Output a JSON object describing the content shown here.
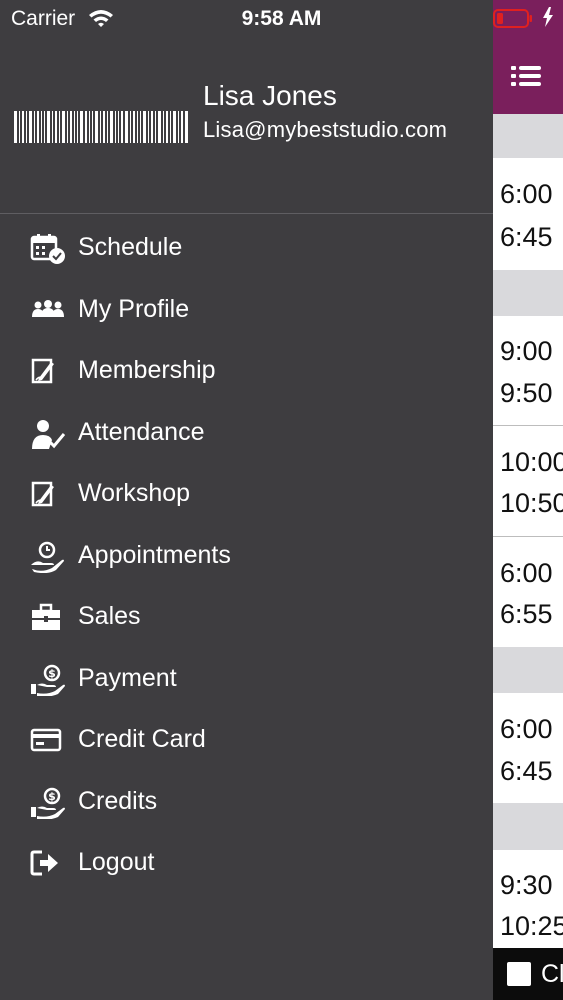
{
  "status_bar": {
    "carrier": "Carrier",
    "time": "9:58 AM"
  },
  "profile": {
    "name": "Lisa Jones",
    "email": "Lisa@mybeststudio.com"
  },
  "menu": [
    {
      "label": "Schedule",
      "icon": "calendar-check-icon"
    },
    {
      "label": "My Profile",
      "icon": "users-icon"
    },
    {
      "label": "Membership",
      "icon": "document-pen-icon"
    },
    {
      "label": "Attendance",
      "icon": "person-check-icon"
    },
    {
      "label": "Workshop",
      "icon": "document-pen-icon"
    },
    {
      "label": "Appointments",
      "icon": "hand-clock-icon"
    },
    {
      "label": "Sales",
      "icon": "briefcase-icon"
    },
    {
      "label": "Payment",
      "icon": "hand-dollar-icon"
    },
    {
      "label": "Credit Card",
      "icon": "credit-card-icon"
    },
    {
      "label": "Credits",
      "icon": "hand-dollar-icon"
    },
    {
      "label": "Logout",
      "icon": "logout-icon"
    }
  ],
  "background_schedule": {
    "cards": [
      {
        "start": "6:00",
        "end": "6:45"
      },
      {
        "start": "9:00",
        "end": "9:50"
      },
      {
        "start": "10:00",
        "end": "10:50"
      },
      {
        "start": "6:00",
        "end": "6:55"
      },
      {
        "start": "6:00",
        "end": "6:45"
      },
      {
        "start": "9:30",
        "end": "10:25"
      }
    ],
    "bottom_label": "Cl"
  },
  "colors": {
    "drawer_bg": "#3e3d40",
    "header_accent": "#7a1f5c",
    "battery_low": "#e02020"
  }
}
